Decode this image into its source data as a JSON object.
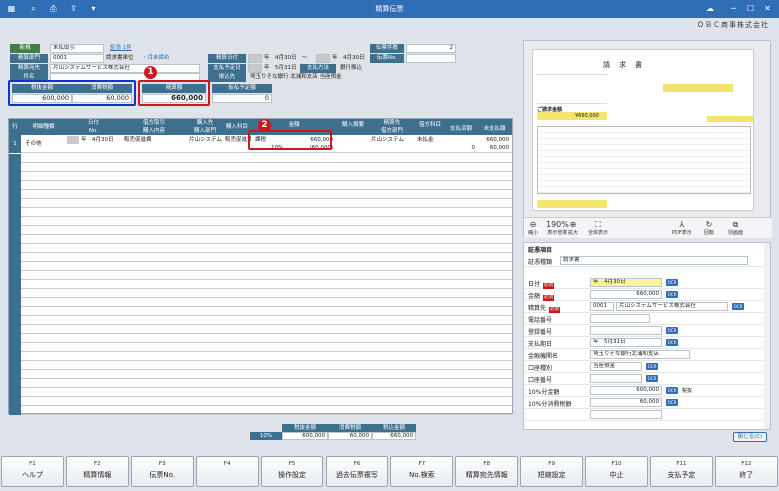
{
  "window": {
    "title": "精算伝票",
    "company": "ＯＢＣ商事株式会社"
  },
  "header": {
    "mode_label": "新規",
    "mode_value": "未払取引",
    "evidence_label": "証憑 1件",
    "branch_label": "精算部門",
    "branch_code": "0001",
    "branch_name": "請求書単位",
    "monthly_close": "・月末締め",
    "payee_label": "精算宛先",
    "payee_name": "片山システムサービス株式会社",
    "subject_label": "件名",
    "period_label": "精算日付",
    "period_from": "年　4月30日",
    "period_sep": "〜",
    "period_to": "年　4月30日",
    "pay_date_label": "支払予定日",
    "pay_date": "年　5月31日",
    "pay_method_label": "支払方法",
    "pay_method": "銀行振込",
    "transfer_label": "振込先",
    "transfer_value": "埼玉りそな銀行 北浦和支店 当座預金",
    "slip_count_label": "伝票件数",
    "slip_count": "2",
    "slip_no_label": "伝票No."
  },
  "totals": {
    "tax_excl_label": "税抜金額",
    "tax_excl": "600,000",
    "tax_label": "消費税額",
    "tax": "60,000",
    "settle_label": "精算額",
    "settle": "660,000",
    "advance_label": "仮払予定額",
    "advance": "0"
  },
  "badges": [
    "1",
    "2"
  ],
  "grid": {
    "headers_top": [
      "行",
      "明細種類",
      "日付",
      "借方取引",
      "購入先",
      "",
      "金額",
      "購入摘要",
      "精算先",
      "借方科目",
      "",
      "未支払額"
    ],
    "headers_bottom": [
      "",
      "",
      "No.",
      "購入内容",
      "購入部門",
      "購入科目",
      "",
      "",
      "借方部門",
      "",
      "支払済額",
      ""
    ],
    "row": {
      "num": "1",
      "kind": "その他",
      "date": "年　4月30日",
      "debit_deal": "販売促進費",
      "purchase_from": "片山システム",
      "dept": "販売促進費",
      "tax_type": "課税",
      "amount": "660,000",
      "tax_rate": "10%",
      "tax_amount": "(60,000)",
      "settle_to": "片山システム",
      "debit_account": "未払金",
      "paid": "0",
      "unpaid": "660,000",
      "unpaid2": "60,000"
    }
  },
  "footer_totals": {
    "h_excl": "税抜金額",
    "h_tax": "消費税額",
    "h_incl": "税込金額",
    "rate": "10%",
    "excl": "600,000",
    "tax": "60,000",
    "incl": "660,000"
  },
  "preview": {
    "doc_title": "請　求　書",
    "doc_subtitle": "ご請求金額",
    "doc_amount": "¥660,000",
    "zoom": "190%",
    "tools": [
      "縮小",
      "表示倍率",
      "拡大",
      "全体表示",
      "PDF表示",
      "回転",
      "別画面"
    ]
  },
  "form": {
    "section": "証憑項目",
    "type_label": "証憑種類",
    "type_value": "請求書",
    "date_label": "日付",
    "date_value": "年　4月30日",
    "amount_label": "金額",
    "amount_value": "660,000",
    "payee_label": "精算先",
    "payee_code": "0001",
    "payee_value": "片山システムサービス株式会社",
    "phone_label": "電話番号",
    "reg_label": "登録番号",
    "paydate_label": "支払期日",
    "paydate_value": "年　5月31日",
    "bank_label": "金融機関名",
    "bank_value": "埼玉りそな銀行北浦和支店",
    "acct_type_label": "口座種別",
    "acct_type_value": "当座預金",
    "acct_no_label": "口座番号",
    "amt10_label": "10%分金額",
    "amt10_value": "600,000",
    "tax10_label": "10%分消費税額",
    "tax10_value": "60,000",
    "ocr": "OCR",
    "required": "必須",
    "close_label": "閉じる(C)",
    "tax_excl_tag": "税抜"
  },
  "fkeys": [
    {
      "n": "F1",
      "l": "ヘルプ"
    },
    {
      "n": "F2",
      "l": "精算情報"
    },
    {
      "n": "F3",
      "l": "伝票No."
    },
    {
      "n": "F4",
      "l": ""
    },
    {
      "n": "F5",
      "l": "操作設定"
    },
    {
      "n": "F6",
      "l": "過去伝票複写"
    },
    {
      "n": "F7",
      "l": "No.検索"
    },
    {
      "n": "F8",
      "l": "精算宛先情報"
    },
    {
      "n": "F9",
      "l": "短縮設定"
    },
    {
      "n": "F10",
      "l": "中止"
    },
    {
      "n": "F11",
      "l": "支払予定"
    },
    {
      "n": "F12",
      "l": "終了"
    }
  ],
  "colors": {
    "titlebar": "#2f6db5",
    "label": "#3d6f8e",
    "highlight_red": "#d0161d",
    "highlight_blue": "#1631c7"
  }
}
